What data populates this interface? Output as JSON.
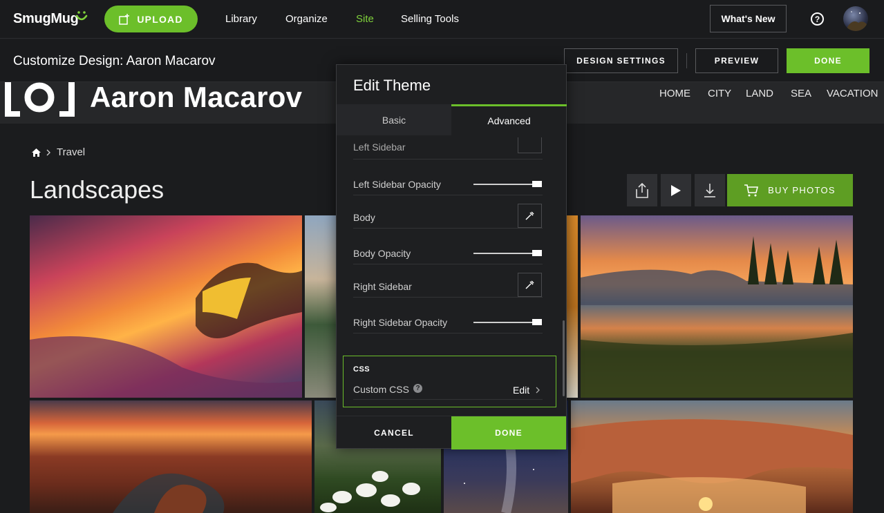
{
  "topbar": {
    "logo": "SmugMug",
    "upload_label": "UPLOAD",
    "nav": [
      "Library",
      "Organize",
      "Site",
      "Selling Tools"
    ],
    "active_nav": "Site",
    "whats_new": "What's New",
    "help_glyph": "?"
  },
  "customize": {
    "title": "Customize Design: Aaron Macarov",
    "design_settings": "DESIGN SETTINGS",
    "preview": "PREVIEW",
    "done": "DONE"
  },
  "site": {
    "name": "Aaron Macarov",
    "nav": [
      "HOME",
      "CITY",
      "LAND",
      "SEA",
      "VACATION"
    ]
  },
  "page": {
    "breadcrumb": "Travel",
    "title": "Landscapes",
    "buy_photos": "BUY PHOTOS"
  },
  "modal": {
    "title": "Edit Theme",
    "tabs": [
      "Basic",
      "Advanced"
    ],
    "active_tab": "Advanced",
    "partial_label": "Left Sidebar",
    "rows": {
      "left_sidebar_opacity": "Left Sidebar Opacity",
      "body": "Body",
      "body_opacity": "Body Opacity",
      "right_sidebar": "Right Sidebar",
      "right_sidebar_opacity": "Right Sidebar Opacity"
    },
    "css_heading": "CSS",
    "custom_css": "Custom CSS",
    "edit": "Edit",
    "cancel": "CANCEL",
    "done": "DONE"
  },
  "colors": {
    "accent": "#6cbf2a",
    "active_nav": "#7fd13b",
    "background": "#1b1c1e"
  },
  "icons": [
    "smile-icon",
    "upload-icon",
    "help-icon",
    "home-icon",
    "chevron-right-icon",
    "share-icon",
    "play-icon",
    "download-icon",
    "cart-icon",
    "eyedropper-icon",
    "help-circle-icon"
  ]
}
